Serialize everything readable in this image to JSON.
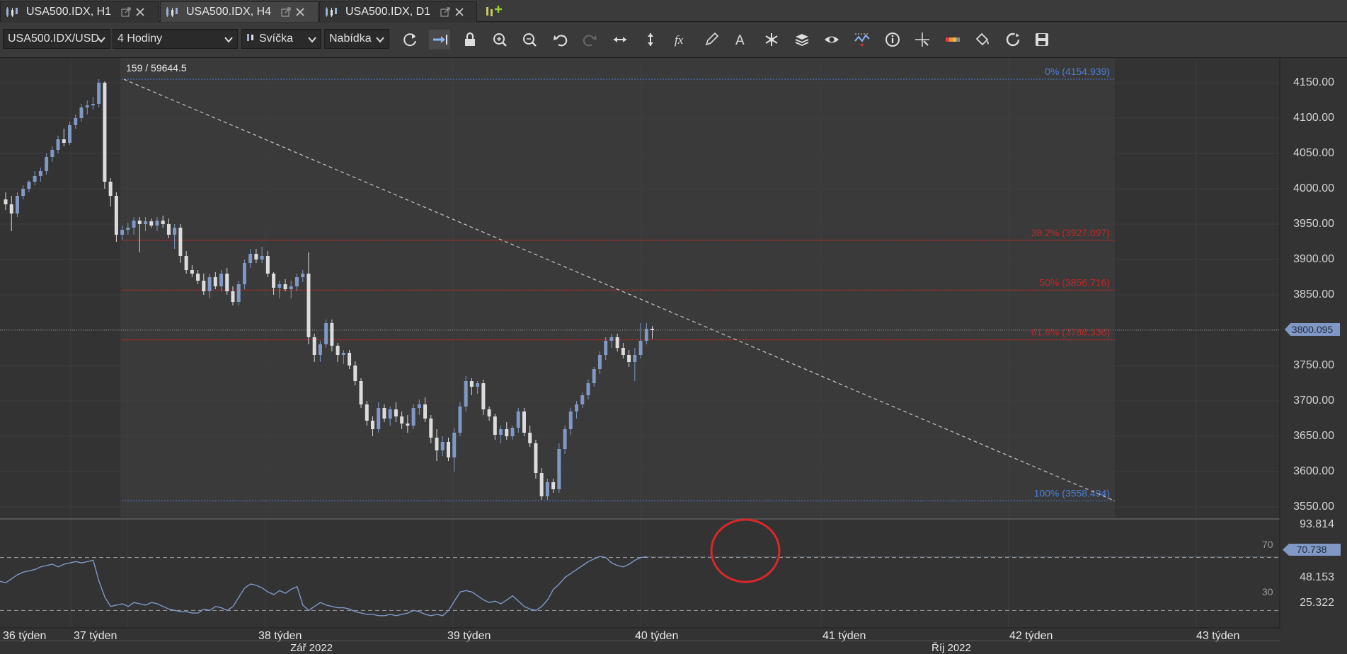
{
  "tabs": [
    {
      "label": "USA500.IDX, H1"
    },
    {
      "label": "USA500.IDX, H4"
    },
    {
      "label": "USA500.IDX, D1"
    }
  ],
  "toolbar": {
    "instrument": "USA500.IDX/USD",
    "period": "4 Hodiny",
    "chart_type": "Svíčka",
    "side": "Nabídka",
    "tools": [
      "refresh-icon",
      "shift-chart-icon",
      "lock-icon",
      "zoom-in-icon",
      "zoom-out-icon",
      "undo-icon",
      "redo-icon",
      "horizontal-scale-icon",
      "vertical-scale-icon",
      "indicators-icon",
      "draw-pencil-icon",
      "text-tool-icon",
      "crosshair-star-icon",
      "layers-icon",
      "visibility-eye-icon",
      "alerts-icon",
      "info-icon",
      "cursor-cross-icon",
      "color-scheme-icon",
      "fill-bucket-icon",
      "cycle-icon",
      "save-icon"
    ]
  },
  "chart": {
    "cursor_readout": "159 / 59644.5",
    "current_price": "3800.095",
    "price_axis": [
      "4150.00",
      "4100.00",
      "4050.00",
      "4000.00",
      "3950.00",
      "3900.00",
      "3850.00",
      "3800.00",
      "3750.00",
      "3700.00",
      "3650.00",
      "3600.00",
      "3550.00"
    ],
    "fib_levels": [
      {
        "label": "0% (4154.939)",
        "price": 4154.939,
        "color": "#4d7fd6"
      },
      {
        "label": "38.2% (3927.097)",
        "price": 3927.097,
        "color": "#c02828"
      },
      {
        "label": "50% (3856.716)",
        "price": 3856.716,
        "color": "#c02828"
      },
      {
        "label": "61.8% (3786.336)",
        "price": 3786.336,
        "color": "#c02828"
      },
      {
        "label": "100% (3558.494)",
        "price": 3558.494,
        "color": "#4d7fd6"
      }
    ],
    "colors": {
      "bull": "#7f98c4",
      "bear": "#dcdcdc",
      "rsi_line": "#7f98c4",
      "highlight_circle": "#d8282a"
    }
  },
  "rsi": {
    "axis": [
      "93.814",
      "48.153",
      "25.322"
    ],
    "level_high": "70",
    "level_low": "30",
    "current": "70.738"
  },
  "time_axis": {
    "weeks": [
      "36 týden",
      "37 týden",
      "38 týden",
      "39 týden",
      "40 týden",
      "41 týden",
      "42 týden",
      "43 týden"
    ],
    "months": [
      "Zář 2022",
      "Říj 2022"
    ]
  },
  "chart_data": {
    "type": "candlestick",
    "instrument": "USA500.IDX",
    "ylim": [
      3535,
      4185
    ],
    "candles": [
      [
        3985,
        3995,
        3970,
        3978
      ],
      [
        3978,
        3990,
        3940,
        3965
      ],
      [
        3965,
        3995,
        3960,
        3990
      ],
      [
        3990,
        4005,
        3985,
        4000
      ],
      [
        4000,
        4012,
        3995,
        4010
      ],
      [
        4010,
        4025,
        4005,
        4018
      ],
      [
        4018,
        4030,
        4010,
        4025
      ],
      [
        4025,
        4050,
        4020,
        4045
      ],
      [
        4045,
        4060,
        4038,
        4055
      ],
      [
        4055,
        4075,
        4050,
        4070
      ],
      [
        4070,
        4085,
        4060,
        4065
      ],
      [
        4065,
        4095,
        4062,
        4090
      ],
      [
        4090,
        4105,
        4085,
        4100
      ],
      [
        4100,
        4120,
        4095,
        4115
      ],
      [
        4115,
        4125,
        4105,
        4118
      ],
      [
        4118,
        4130,
        4112,
        4120
      ],
      [
        4120,
        4155,
        4115,
        4150
      ],
      [
        4150,
        4152,
        4000,
        4010
      ],
      [
        4010,
        4015,
        3975,
        3990
      ],
      [
        3990,
        3995,
        3925,
        3935
      ],
      [
        3935,
        3948,
        3928,
        3942
      ],
      [
        3942,
        3952,
        3935,
        3945
      ],
      [
        3945,
        3960,
        3935,
        3955
      ],
      [
        3955,
        3960,
        3910,
        3950
      ],
      [
        3950,
        3960,
        3940,
        3954
      ],
      [
        3954,
        3958,
        3945,
        3948
      ],
      [
        3948,
        3960,
        3940,
        3955
      ],
      [
        3955,
        3962,
        3945,
        3950
      ],
      [
        3950,
        3958,
        3930,
        3935
      ],
      [
        3935,
        3950,
        3915,
        3945
      ],
      [
        3945,
        3950,
        3895,
        3905
      ],
      [
        3905,
        3912,
        3880,
        3885
      ],
      [
        3885,
        3892,
        3875,
        3880
      ],
      [
        3880,
        3885,
        3865,
        3870
      ],
      [
        3870,
        3880,
        3850,
        3855
      ],
      [
        3855,
        3880,
        3845,
        3875
      ],
      [
        3875,
        3882,
        3858,
        3862
      ],
      [
        3862,
        3885,
        3855,
        3880
      ],
      [
        3880,
        3888,
        3850,
        3855
      ],
      [
        3855,
        3862,
        3835,
        3840
      ],
      [
        3840,
        3870,
        3835,
        3865
      ],
      [
        3865,
        3900,
        3858,
        3895
      ],
      [
        3895,
        3915,
        3888,
        3908
      ],
      [
        3908,
        3915,
        3895,
        3900
      ],
      [
        3900,
        3918,
        3895,
        3905
      ],
      [
        3905,
        3912,
        3875,
        3880
      ],
      [
        3880,
        3882,
        3850,
        3860
      ],
      [
        3860,
        3870,
        3845,
        3865
      ],
      [
        3865,
        3872,
        3855,
        3858
      ],
      [
        3858,
        3870,
        3845,
        3862
      ],
      [
        3862,
        3880,
        3855,
        3875
      ],
      [
        3875,
        3885,
        3868,
        3880
      ],
      [
        3880,
        3910,
        3780,
        3790
      ],
      [
        3790,
        3795,
        3755,
        3765
      ],
      [
        3765,
        3785,
        3755,
        3780
      ],
      [
        3780,
        3815,
        3775,
        3810
      ],
      [
        3810,
        3815,
        3770,
        3778
      ],
      [
        3778,
        3782,
        3755,
        3765
      ],
      [
        3765,
        3772,
        3752,
        3768
      ],
      [
        3768,
        3772,
        3745,
        3750
      ],
      [
        3750,
        3756,
        3722,
        3728
      ],
      [
        3728,
        3732,
        3690,
        3695
      ],
      [
        3695,
        3700,
        3665,
        3672
      ],
      [
        3672,
        3678,
        3650,
        3660
      ],
      [
        3660,
        3698,
        3655,
        3690
      ],
      [
        3690,
        3695,
        3670,
        3675
      ],
      [
        3675,
        3692,
        3665,
        3688
      ],
      [
        3688,
        3698,
        3670,
        3678
      ],
      [
        3678,
        3685,
        3660,
        3668
      ],
      [
        3668,
        3680,
        3655,
        3665
      ],
      [
        3665,
        3695,
        3660,
        3690
      ],
      [
        3690,
        3702,
        3680,
        3695
      ],
      [
        3695,
        3705,
        3670,
        3675
      ],
      [
        3675,
        3680,
        3640,
        3648
      ],
      [
        3648,
        3660,
        3615,
        3630
      ],
      [
        3630,
        3650,
        3622,
        3642
      ],
      [
        3642,
        3648,
        3615,
        3620
      ],
      [
        3620,
        3662,
        3600,
        3655
      ],
      [
        3655,
        3698,
        3650,
        3692
      ],
      [
        3692,
        3735,
        3685,
        3728
      ],
      [
        3728,
        3732,
        3708,
        3720
      ],
      [
        3720,
        3728,
        3710,
        3725
      ],
      [
        3725,
        3730,
        3680,
        3688
      ],
      [
        3688,
        3692,
        3672,
        3678
      ],
      [
        3678,
        3682,
        3645,
        3652
      ],
      [
        3652,
        3665,
        3640,
        3660
      ],
      [
        3660,
        3670,
        3645,
        3650
      ],
      [
        3650,
        3665,
        3645,
        3662
      ],
      [
        3662,
        3690,
        3655,
        3685
      ],
      [
        3685,
        3690,
        3650,
        3655
      ],
      [
        3655,
        3665,
        3635,
        3640
      ],
      [
        3640,
        3645,
        3590,
        3598
      ],
      [
        3598,
        3605,
        3560,
        3565
      ],
      [
        3565,
        3590,
        3560,
        3585
      ],
      [
        3585,
        3590,
        3570,
        3575
      ],
      [
        3575,
        3640,
        3570,
        3632
      ],
      [
        3632,
        3665,
        3625,
        3660
      ],
      [
        3660,
        3690,
        3652,
        3685
      ],
      [
        3685,
        3700,
        3675,
        3695
      ],
      [
        3695,
        3712,
        3690,
        3708
      ],
      [
        3708,
        3730,
        3702,
        3725
      ],
      [
        3725,
        3748,
        3720,
        3745
      ],
      [
        3745,
        3770,
        3738,
        3765
      ],
      [
        3765,
        3790,
        3758,
        3785
      ],
      [
        3785,
        3795,
        3775,
        3790
      ],
      [
        3790,
        3795,
        3770,
        3775
      ],
      [
        3775,
        3782,
        3760,
        3765
      ],
      [
        3765,
        3772,
        3748,
        3755
      ],
      [
        3755,
        3775,
        3728,
        3765
      ],
      [
        3765,
        3810,
        3760,
        3785
      ],
      [
        3785,
        3810,
        3780,
        3802
      ],
      [
        3802,
        3806,
        3788,
        3800
      ]
    ],
    "rsi": [
      52,
      51,
      54,
      57,
      59,
      60,
      61,
      63,
      64,
      65,
      63,
      65,
      66,
      67,
      66,
      67,
      68,
      52,
      40,
      33,
      34,
      35,
      33,
      36,
      35,
      34,
      36,
      35,
      33,
      31,
      30,
      29,
      29,
      28,
      28,
      31,
      30,
      33,
      32,
      30,
      33,
      40,
      47,
      50,
      49,
      47,
      44,
      42,
      45,
      43,
      46,
      48,
      34,
      30,
      33,
      36,
      34,
      33,
      32,
      32,
      31,
      29,
      28,
      27,
      27,
      26,
      26,
      27,
      26,
      27,
      28,
      30,
      29,
      27,
      26,
      27,
      26,
      30,
      37,
      44,
      45,
      44,
      41,
      38,
      36,
      37,
      35,
      38,
      41,
      37,
      33,
      31,
      30,
      33,
      38,
      46,
      50,
      55,
      58,
      61,
      64,
      67,
      69,
      71,
      70,
      66,
      64,
      63,
      65,
      68,
      70,
      70.7
    ]
  }
}
